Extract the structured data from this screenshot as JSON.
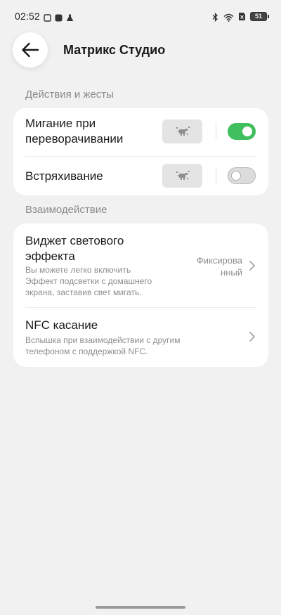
{
  "status_bar": {
    "time": "02:52",
    "battery": "51"
  },
  "header": {
    "title": "Матрикс Студио"
  },
  "sections": {
    "gestures": {
      "title": "Действия и жесты",
      "items": [
        {
          "label_line1": "Мигание при",
          "label_line2": "переворачивании",
          "toggle": true
        },
        {
          "label": "Встряхивание",
          "toggle": false
        }
      ]
    },
    "interaction": {
      "title": "Взаимодействие",
      "items": [
        {
          "label_line1": "Виджет светового",
          "label_line2": "эффекта",
          "desc_line1": "Вы можете легко включить",
          "desc_line2": "Эффект подсветки с домашнего",
          "desc_line3": "экрана, заставив свет мигать.",
          "value_line1": "Фиксирова",
          "value_line2": "нный"
        },
        {
          "label": "NFC касание",
          "desc_line1": "Вспышка при взаимодействии с другим",
          "desc_line2": "телефоном с поддержкой NFC."
        }
      ]
    }
  },
  "colors": {
    "background": "#f1f1f1",
    "card": "#ffffff",
    "toggle_on": "#3fbf5e",
    "section_header": "#8a8a8a"
  }
}
